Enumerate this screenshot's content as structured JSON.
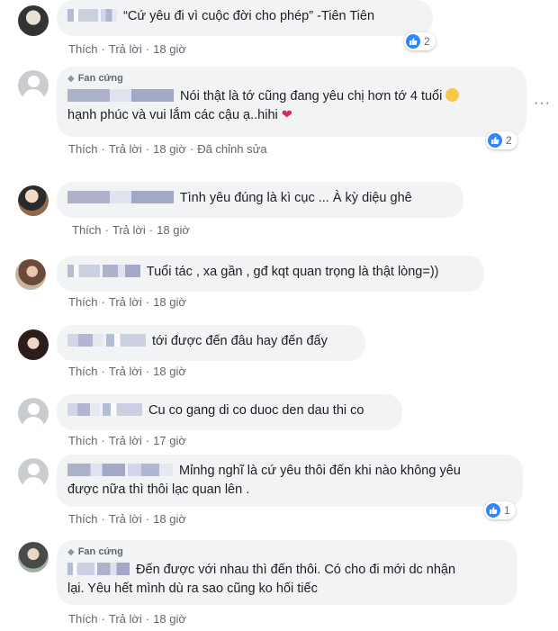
{
  "comments": [
    {
      "text": "“Cứ yêu đi vì cuộc đời cho phép” -Tiên Tiên",
      "actions": {
        "like": "Thích",
        "reply": "Trả lời",
        "time": "18 giờ",
        "edited": ""
      },
      "reactions": "2"
    },
    {
      "badge": "Fan cứng",
      "text": "Nói thật là tớ cũng đang yêu chị hơn tớ 4 tuổi",
      "text2": "hạnh phúc và vui lắm các cậu ạ..hihi",
      "actions": {
        "like": "Thích",
        "reply": "Trả lời",
        "time": "18 giờ",
        "edited": "Đã chỉnh sửa"
      },
      "reactions": "2"
    },
    {
      "text": "Tình yêu đúng là kì cục ... À kỳ diệu ghê",
      "actions": {
        "like": "Thích",
        "reply": "Trả lời",
        "time": "18 giờ"
      }
    },
    {
      "text": "Tuổi tác , xa gần , gđ kqt quan trọng là thật lòng=))",
      "actions": {
        "like": "Thích",
        "reply": "Trả lời",
        "time": "18 giờ"
      }
    },
    {
      "text": "tới được đến đâu hay đến đấy",
      "actions": {
        "like": "Thích",
        "reply": "Trả lời",
        "time": "18 giờ"
      }
    },
    {
      "text": "Cu co gang di co duoc den dau thi co",
      "actions": {
        "like": "Thích",
        "reply": "Trả lời",
        "time": "17 giờ"
      }
    },
    {
      "text": "Mỉnhg nghĩ là cứ yêu thôi đến khi nào không yêu",
      "text2": "được nữa thì thôi lạc quan lên .",
      "actions": {
        "like": "Thích",
        "reply": "Trả lời",
        "time": "18 giờ"
      },
      "reactions": "1"
    },
    {
      "badge": "Fan cứng",
      "text": "Đến được với nhau thì đến thôi. Có cho đi mới dc nhận",
      "text2": "lại. Yêu hết mình dù ra sao cũng ko hối tiếc",
      "actions": {
        "like": "Thích",
        "reply": "Trả lời",
        "time": "18 giờ"
      }
    }
  ],
  "separator": "·",
  "more_glyph": "···",
  "colors": {
    "bubble": "#f2f3f5",
    "meta": "#606770",
    "like_blue": "#2d88ff",
    "heart": "#e0245e"
  }
}
